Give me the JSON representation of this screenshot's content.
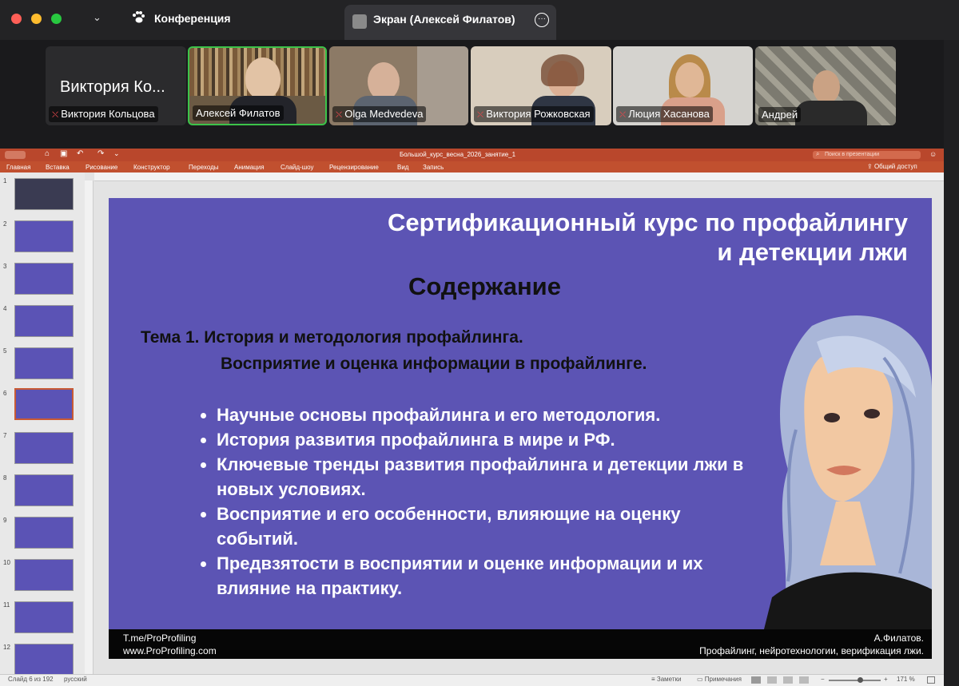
{
  "window": {
    "conference_label": "Конференция",
    "screen_tab_label": "Экран (Алексей Филатов)",
    "colors": {
      "close": "#ff5f57",
      "minimize": "#febc2e",
      "maximize": "#28c840",
      "active_speaker": "#3cc34a"
    }
  },
  "participants": {
    "large_name": "Виктория Ко...",
    "tiles": [
      {
        "name": "Виктория Кольцова",
        "muted": true
      },
      {
        "name": "Алексей Филатов",
        "muted": false
      },
      {
        "name": "Olga Medvedeva",
        "muted": true
      },
      {
        "name": "Виктория Рожковская",
        "muted": true
      },
      {
        "name": "Люция Хасанова",
        "muted": true
      },
      {
        "name": "Андрей",
        "muted": false
      }
    ]
  },
  "ppt": {
    "document_title": "Большой_курс_весна_2026_занятие_1",
    "search_placeholder": "Поиск в презентации",
    "share_label": "Общий доступ",
    "tabs": [
      "Главная",
      "Вставка",
      "Рисование",
      "Конструктор",
      "Переходы",
      "Анимация",
      "Слайд-шоу",
      "Рецензирование",
      "Вид",
      "Запись"
    ],
    "thumb_numbers": [
      "1",
      "2",
      "3",
      "4",
      "5",
      "6",
      "7",
      "8",
      "9",
      "10",
      "11",
      "12"
    ],
    "selected_thumb": 6,
    "status": {
      "slide_position": "Слайд 6 из 192",
      "language": "русский",
      "notes": "Заметки",
      "comments": "Примечания",
      "zoom": "171 %"
    }
  },
  "slide": {
    "title_line1": "Сертификационный курс по профайлингу",
    "title_line2": "и детекции лжи",
    "heading": "Содержание",
    "topic_line1": "Тема 1. История и методология профайлинга.",
    "topic_line2": "Восприятие и оценка информации в профайлинге.",
    "bullets": [
      "Научные основы профайлинга и его методология.",
      "История развития профайлинга в мире и РФ.",
      "Ключевые тренды развития профайлинга и детекции лжи в новых условиях.",
      "Восприятие и его особенности, влияющие на оценку событий.",
      "Предвзятости в восприятии и оценке информации и их влияние на практику."
    ],
    "footer_left1": "T.me/ProProfiling",
    "footer_left2": "www.ProProfiling.com",
    "footer_right1": "А.Филатов.",
    "footer_right2": "Профайлинг, нейротехнологии, верификация лжи."
  }
}
